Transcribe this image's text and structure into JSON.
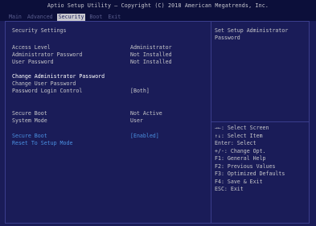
{
  "header": {
    "title": "Aptio Setup Utility – Copyright (C) 2018 American Megatrends, Inc.",
    "tabs": [
      {
        "label": "Main"
      },
      {
        "label": "Advanced"
      },
      {
        "label": "Security"
      },
      {
        "label": "Boot"
      },
      {
        "label": "Exit"
      }
    ]
  },
  "main": {
    "section_title": "Security Settings",
    "access_level_label": "Access Level",
    "access_level_value": "Administrator",
    "admin_password_label": "Administrator Password",
    "admin_password_value": "Not Installed",
    "user_password_label": "User Password",
    "user_password_value": "Not Installed",
    "change_admin_password": "Change Administrator Password",
    "change_user_password": "Change User Password",
    "password_login_control_label": "Password Login Control",
    "password_login_control_value": "[Both]",
    "secure_boot_status_label": "Secure Boot",
    "secure_boot_status_value": "Not Active",
    "system_mode_label": "System Mode",
    "system_mode_value": "User",
    "secure_boot_option_label": "Secure Boot",
    "secure_boot_option_value": "[Enabled]",
    "reset_to_setup_mode": "Reset To Setup Mode"
  },
  "help": {
    "text": "Set Setup Administrator Password"
  },
  "keys": [
    "→←: Select Screen",
    "↑↓: Select Item",
    "Enter: Select",
    "+/-: Change Opt.",
    "F1: General Help",
    "F2: Previous Values",
    "F3: Optimized Defaults",
    "F4: Save & Exit",
    "ESC: Exit"
  ],
  "colors": {
    "background": "#1a1c58",
    "title_bar": "#0c0f3a",
    "active_tab": "#c8c8cf",
    "text": "#c4c4c8",
    "highlight": "#ffffff",
    "link_blue": "#4a8fe0"
  }
}
